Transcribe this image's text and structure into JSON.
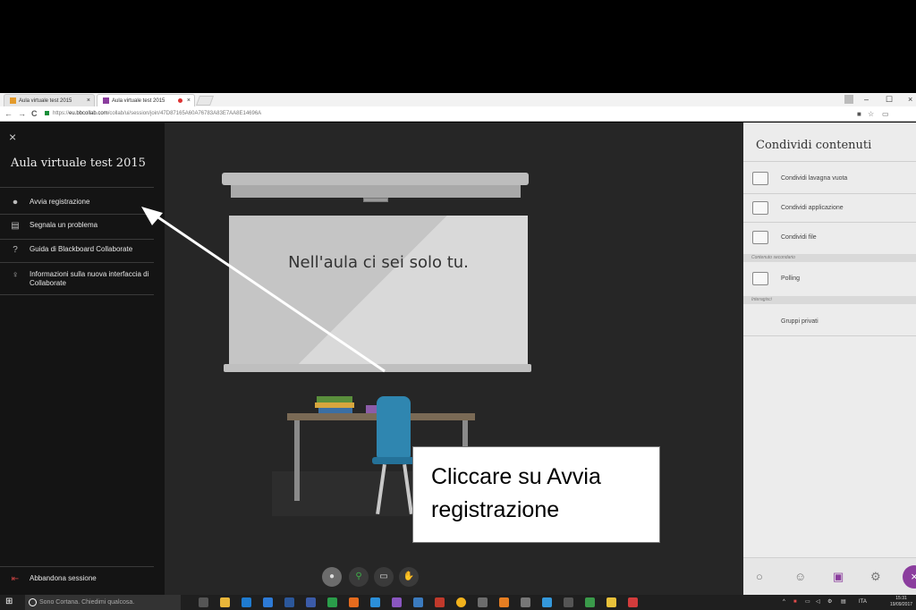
{
  "browser": {
    "tabs": [
      {
        "label": "Aula virtuale test 2015",
        "close": "×"
      },
      {
        "label": "Aula virtuale test 2015",
        "close": "×"
      }
    ],
    "window_controls": [
      "–",
      "☐",
      "×"
    ],
    "url_scheme": "https://",
    "url_host": "eu.bbcollab.com",
    "url_path": "/collab/ui/session/join/47D87165A60A76783A83E7AA8E14696A",
    "nav": {
      "back": "←",
      "forward": "→",
      "reload": "C"
    },
    "extensions": [
      "■",
      "☆",
      "▭"
    ]
  },
  "left_panel": {
    "close": "×",
    "title": "Aula virtuale test 2015",
    "items": [
      {
        "label": "Avvia registrazione",
        "icon": "record-icon"
      },
      {
        "label": "Segnala un problema",
        "icon": "report-icon"
      },
      {
        "label": "Guida di Blackboard Collaborate",
        "icon": "help-icon"
      },
      {
        "label": "Informazioni sulla nuova interfaccia di Collaborate",
        "icon": "lightbulb-icon"
      }
    ],
    "leave_label": "Abbandona sessione"
  },
  "stage": {
    "message": "Nell'aula ci sei solo tu."
  },
  "callout": {
    "text": "Cliccare su Avvia registrazione"
  },
  "right_panel": {
    "title": "Condividi contenuti",
    "items": [
      {
        "label": "Condividi lavagna vuota"
      },
      {
        "label": "Condividi applicazione"
      },
      {
        "label": "Condividi file"
      }
    ],
    "section_secondary": "Contenuto secondario",
    "polling": "Polling",
    "section_interact": "Interagisci",
    "private_groups": "Gruppi privati"
  },
  "taskbar": {
    "cortana": "Sono Cortana. Chiedimi qualcosa.",
    "lang": "ITA",
    "time": "15:31",
    "date": "19/09/2017"
  },
  "colors": {
    "accent": "#8b3d9e",
    "stage_bg": "#262626",
    "panel_dark": "#141414",
    "panel_light": "#ececec"
  }
}
